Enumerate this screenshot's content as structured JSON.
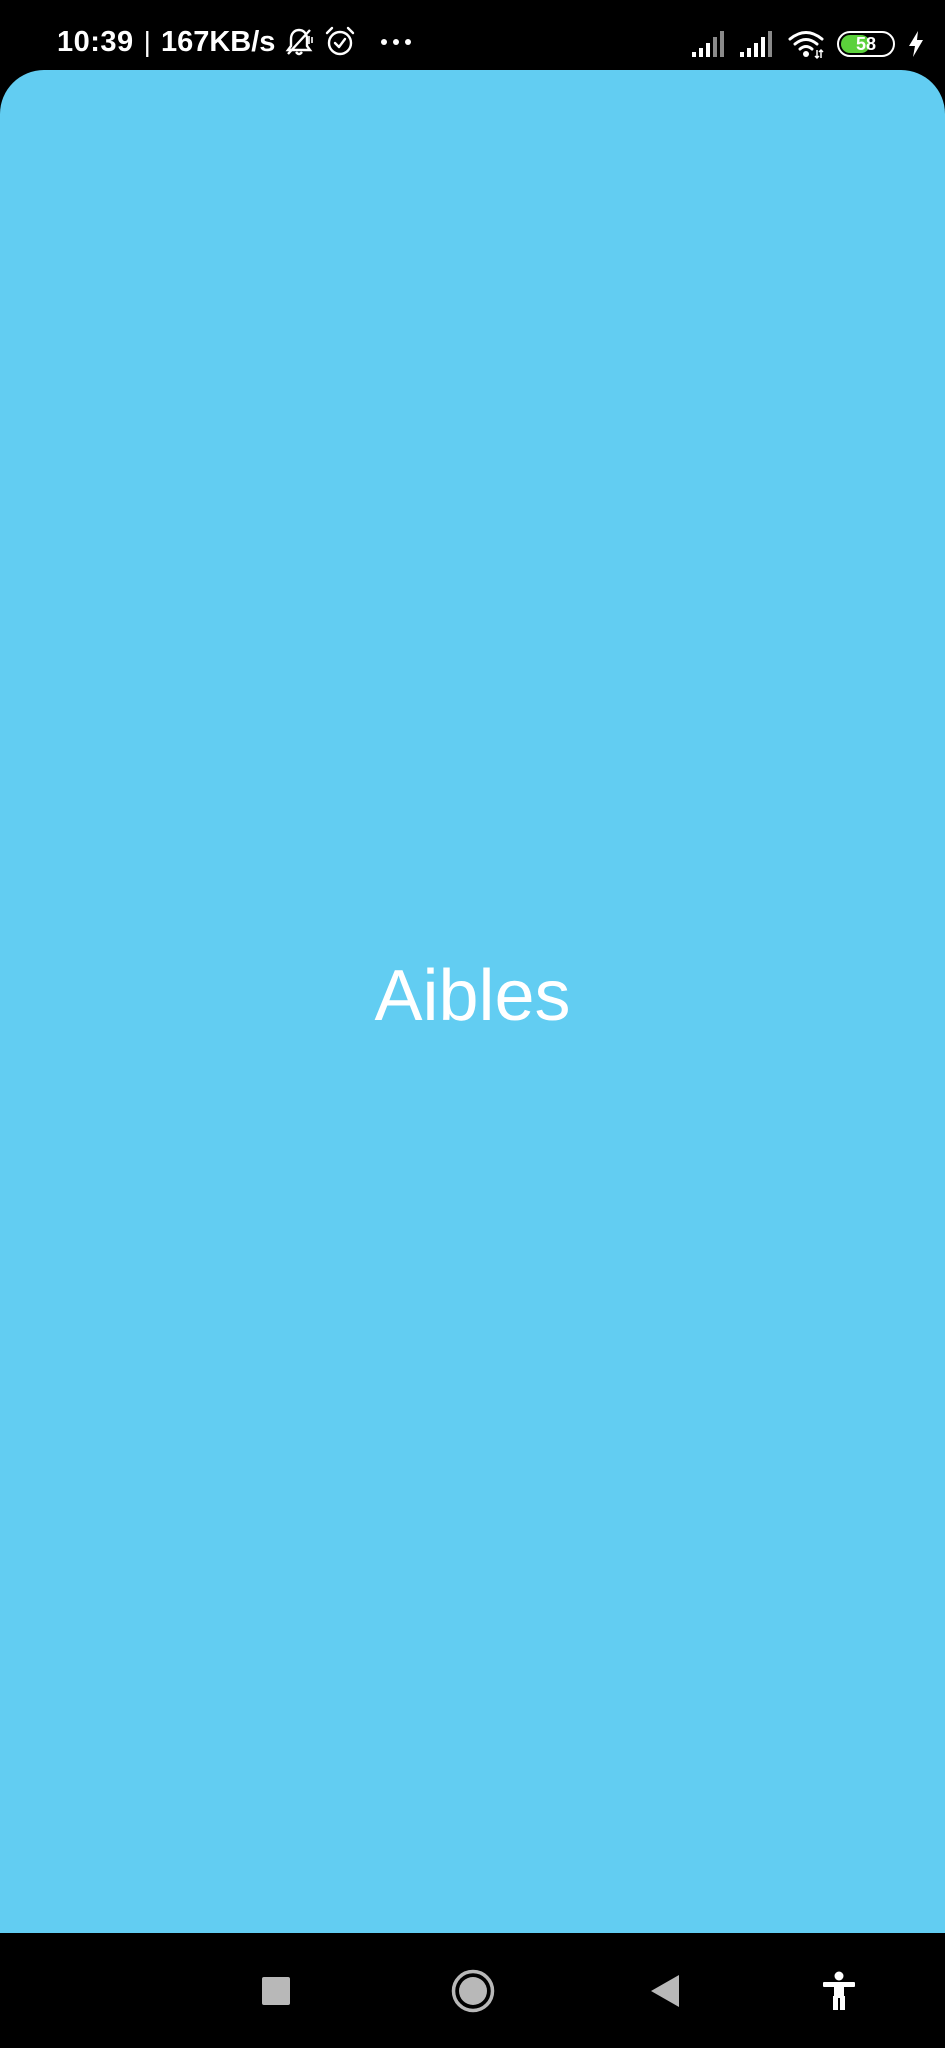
{
  "status_bar": {
    "time": "10:39",
    "separator": "|",
    "network_speed": "167KB/s",
    "battery_level": "58",
    "battery_fill_fraction": 0.58,
    "icons": [
      "bell-muted-icon",
      "alarm-clock-icon",
      "more-dots-icon",
      "signal-icon",
      "signal-icon",
      "wifi-icon",
      "battery-icon",
      "charging-bolt-icon"
    ]
  },
  "app": {
    "title": "Aibles"
  },
  "nav_bar": {
    "icons": [
      "recents-square-icon",
      "home-circle-icon",
      "back-triangle-icon",
      "accessibility-icon"
    ]
  },
  "colors": {
    "splash_background": "#62CDF2",
    "splash_text": "#FFFFFF",
    "system_bar": "#000000",
    "battery_fill": "#5BD13B"
  }
}
